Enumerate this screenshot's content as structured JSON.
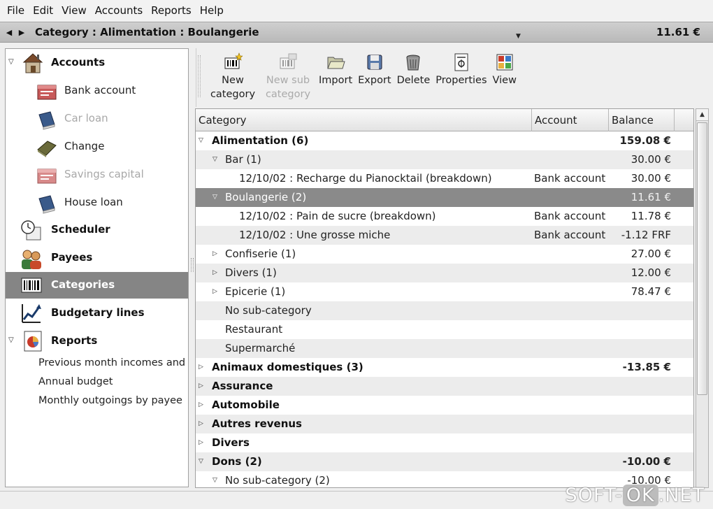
{
  "menubar": {
    "items": [
      {
        "label": "File"
      },
      {
        "label": "Edit"
      },
      {
        "label": "View"
      },
      {
        "label": "Accounts"
      },
      {
        "label": "Reports"
      },
      {
        "label": "Help"
      }
    ]
  },
  "navbar": {
    "title": "Category : Alimentation : Boulangerie",
    "balance": "11.61 €"
  },
  "sidebar": {
    "accounts_label": "Accounts",
    "accounts": [
      {
        "label": "Bank account",
        "icon": "bank-account-icon",
        "disabled": false
      },
      {
        "label": "Car loan",
        "icon": "book-icon",
        "disabled": true
      },
      {
        "label": "Change",
        "icon": "cash-icon",
        "disabled": false
      },
      {
        "label": "Savings capital",
        "icon": "bank-account-icon",
        "disabled": true
      },
      {
        "label": "House loan",
        "icon": "book-icon",
        "disabled": false
      }
    ],
    "scheduler_label": "Scheduler",
    "payees_label": "Payees",
    "categories_label": "Categories",
    "budgetary_label": "Budgetary lines",
    "reports_label": "Reports",
    "reports": [
      {
        "label": "Previous month incomes and"
      },
      {
        "label": "Annual budget"
      },
      {
        "label": "Monthly outgoings by payee"
      }
    ]
  },
  "toolbar": {
    "new_category": "New category",
    "new_sub_category": "New sub category",
    "import": "Import",
    "export": "Export",
    "delete": "Delete",
    "properties": "Properties",
    "view": "View"
  },
  "tree": {
    "columns": {
      "category": "Category",
      "account": "Account",
      "balance": "Balance"
    },
    "rows": [
      {
        "level": 0,
        "expander": "open",
        "label": "Alimentation (6)",
        "account": "",
        "balance": "159.08 €",
        "bold": true,
        "alt": false,
        "selected": false
      },
      {
        "level": 1,
        "expander": "open",
        "label": "Bar (1)",
        "account": "",
        "balance": "30.00 €",
        "bold": false,
        "alt": true,
        "selected": false
      },
      {
        "level": 2,
        "expander": "",
        "label": "12/10/02 : Recharge du Pianocktail (breakdown)",
        "account": "Bank account",
        "balance": "30.00 €",
        "bold": false,
        "alt": false,
        "selected": false
      },
      {
        "level": 1,
        "expander": "open",
        "label": "Boulangerie (2)",
        "account": "",
        "balance": "11.61 €",
        "bold": false,
        "alt": false,
        "selected": true
      },
      {
        "level": 2,
        "expander": "",
        "label": "12/10/02 : Pain de sucre (breakdown)",
        "account": "Bank account",
        "balance": "11.78 €",
        "bold": false,
        "alt": false,
        "selected": false
      },
      {
        "level": 2,
        "expander": "",
        "label": "12/10/02 : Une grosse miche",
        "account": "Bank account",
        "balance": "-1.12 FRF",
        "bold": false,
        "alt": true,
        "selected": false
      },
      {
        "level": 1,
        "expander": "closed",
        "label": "Confiserie (1)",
        "account": "",
        "balance": "27.00 €",
        "bold": false,
        "alt": false,
        "selected": false
      },
      {
        "level": 1,
        "expander": "closed",
        "label": "Divers (1)",
        "account": "",
        "balance": "12.00 €",
        "bold": false,
        "alt": true,
        "selected": false
      },
      {
        "level": 1,
        "expander": "closed",
        "label": "Epicerie (1)",
        "account": "",
        "balance": "78.47 €",
        "bold": false,
        "alt": false,
        "selected": false
      },
      {
        "level": 1,
        "expander": "",
        "label": "No sub-category",
        "account": "",
        "balance": "",
        "bold": false,
        "alt": true,
        "selected": false
      },
      {
        "level": 1,
        "expander": "",
        "label": "Restaurant",
        "account": "",
        "balance": "",
        "bold": false,
        "alt": false,
        "selected": false
      },
      {
        "level": 1,
        "expander": "",
        "label": "Supermarché",
        "account": "",
        "balance": "",
        "bold": false,
        "alt": true,
        "selected": false
      },
      {
        "level": 0,
        "expander": "closed",
        "label": "Animaux domestiques (3)",
        "account": "",
        "balance": "-13.85 €",
        "bold": true,
        "alt": false,
        "selected": false
      },
      {
        "level": 0,
        "expander": "closed",
        "label": "Assurance",
        "account": "",
        "balance": "",
        "bold": true,
        "alt": true,
        "selected": false
      },
      {
        "level": 0,
        "expander": "closed",
        "label": "Automobile",
        "account": "",
        "balance": "",
        "bold": true,
        "alt": false,
        "selected": false
      },
      {
        "level": 0,
        "expander": "closed",
        "label": "Autres revenus",
        "account": "",
        "balance": "",
        "bold": true,
        "alt": true,
        "selected": false
      },
      {
        "level": 0,
        "expander": "closed",
        "label": "Divers",
        "account": "",
        "balance": "",
        "bold": true,
        "alt": false,
        "selected": false
      },
      {
        "level": 0,
        "expander": "open",
        "label": "Dons (2)",
        "account": "",
        "balance": "-10.00 €",
        "bold": true,
        "alt": true,
        "selected": false
      },
      {
        "level": 1,
        "expander": "open",
        "label": "No sub-category (2)",
        "account": "",
        "balance": "-10.00 €",
        "bold": false,
        "alt": false,
        "selected": false
      }
    ]
  },
  "watermark": {
    "left": "SOFT-",
    "ok": "OK",
    "right": ".NET"
  },
  "colors": {
    "selection": "#858585",
    "alt_row": "#ececec",
    "navbar": "#c4c4c4"
  }
}
